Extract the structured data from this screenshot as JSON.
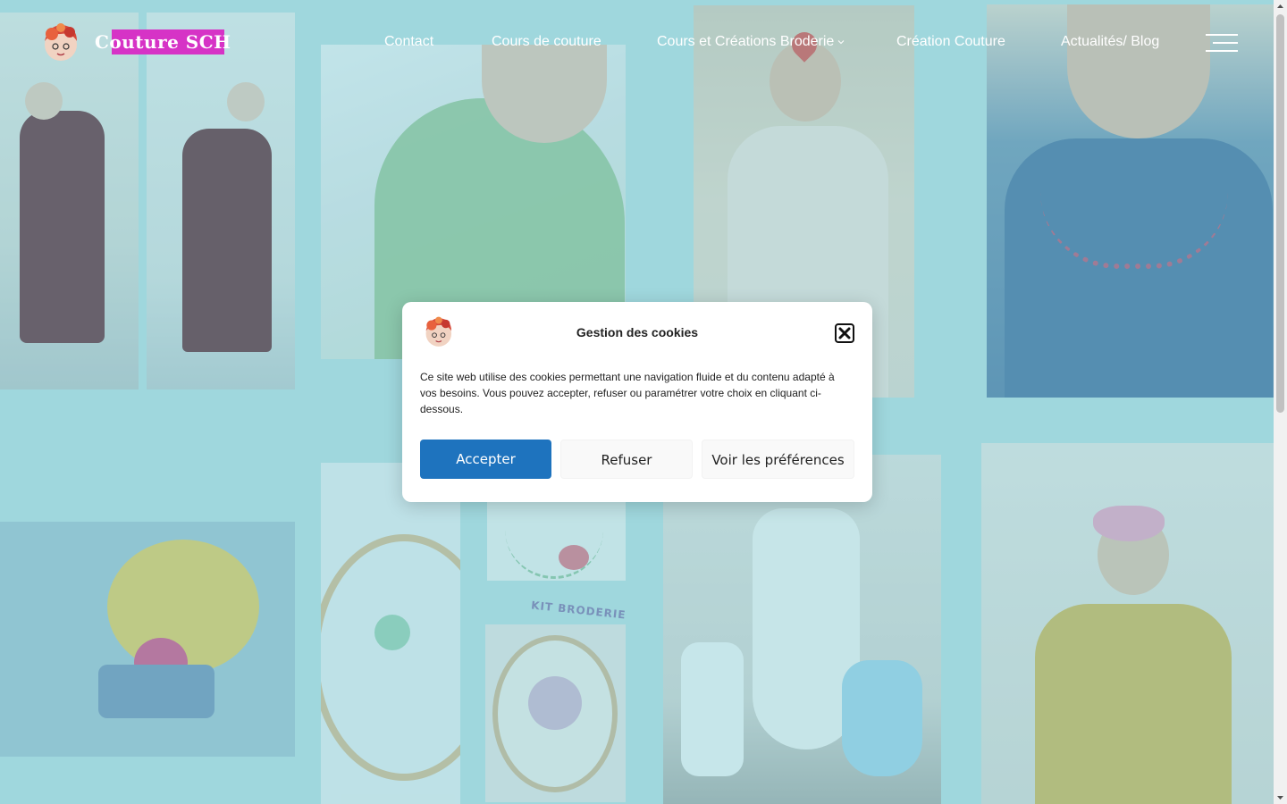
{
  "site": {
    "brand_name": "Couture SCH",
    "brand_highlight_color": "#d633c6"
  },
  "nav": {
    "items": [
      {
        "label": "Contact"
      },
      {
        "label": "Cours de couture"
      },
      {
        "label": "Cours et Créations Broderie",
        "has_submenu": true
      },
      {
        "label": "Création Couture"
      },
      {
        "label": "Actualités/ Blog"
      }
    ],
    "menu_icon": "hamburger-menu-icon"
  },
  "background": {
    "kit_label": "KIT BRODERIE"
  },
  "cookie_modal": {
    "title": "Gestion des cookies",
    "text": "Ce site web utilise des cookies permettant une navigation fluide et du contenu adapté à vos besoins. Vous pouvez accepter, refuser ou paramétrer votre choix en cliquant ci-dessous.",
    "accept_label": "Accepter",
    "refuse_label": "Refuser",
    "preferences_label": "Voir les préférences",
    "close_icon": "close-icon",
    "accent_color": "#1e73be"
  }
}
